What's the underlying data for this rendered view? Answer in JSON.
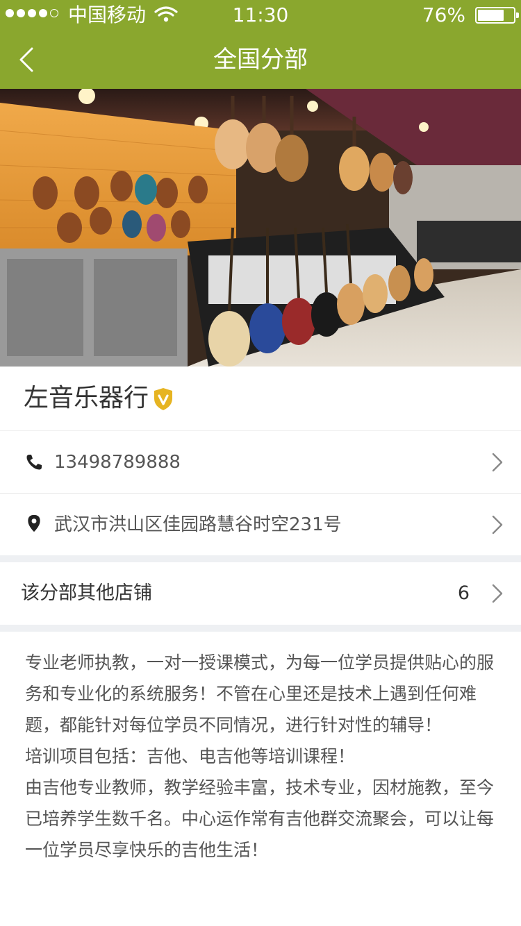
{
  "status_bar": {
    "carrier": "中国移动",
    "time": "11:30",
    "battery_percent": "76%",
    "battery_level": 0.76,
    "signal_bars": 4,
    "signal_total": 5
  },
  "nav": {
    "title": "全国分部",
    "back_icon": "chevron-left-icon"
  },
  "hero": {
    "image_name": "guitar-store-photo"
  },
  "store": {
    "name": "左音乐器行",
    "verified_icon": "verified-badge-icon",
    "phone": "13498789888",
    "address": "武汉市洪山区佳园路慧谷时空231号"
  },
  "other_stores": {
    "label": "该分部其他店铺",
    "count": "6"
  },
  "description": [
    "专业老师执教，一对一授课模式，为每一位学员提供贴心的服务和专业化的系统服务！不管在心里还是技术上遇到任何难题，都能针对每位学员不同情况，进行针对性的辅导！",
    "培训项目包括：吉他、电吉他等培训课程！",
    "由吉他专业教师，教学经验丰富，技术专业，因材施教，至今已培养学生数千名。中心运作常有吉他群交流聚会，可以让每一位学员尽享快乐的吉他生活！"
  ],
  "colors": {
    "accent": "#8aa72e",
    "badge": "#e6b422",
    "separator": "#eef0f3"
  }
}
